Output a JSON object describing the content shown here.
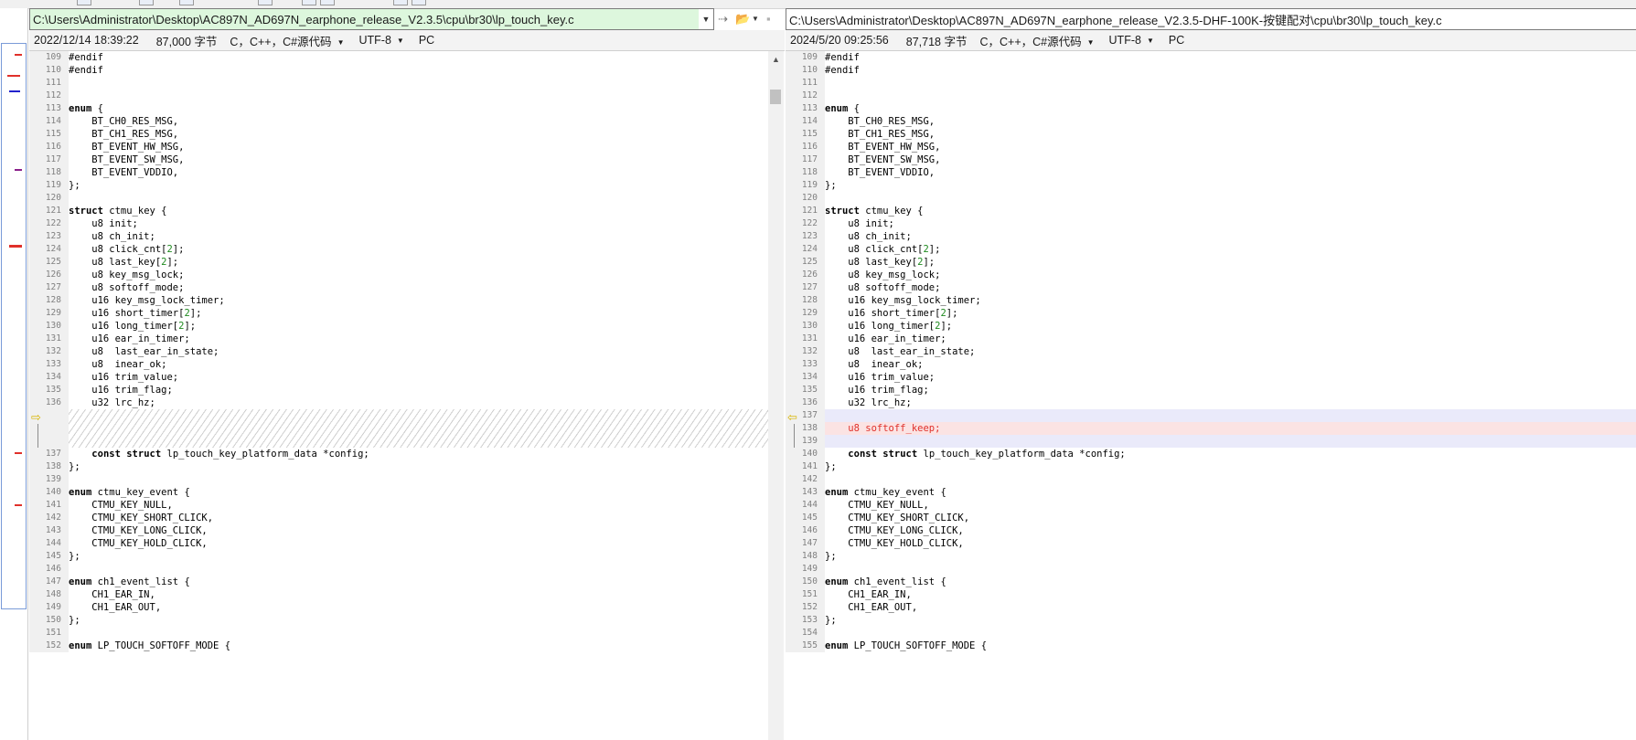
{
  "left": {
    "path": "C:\\Users\\Administrator\\Desktop\\AC897N_AD697N_earphone_release_V2.3.5\\cpu\\br30\\lp_touch_key.c",
    "timestamp": "2022/12/14 18:39:22",
    "size": "87,000 字节",
    "language": "C，C++，C#源代码",
    "encoding": "UTF-8",
    "line_ending": "PC"
  },
  "right": {
    "path": "C:\\Users\\Administrator\\Desktop\\AC897N_AD697N_earphone_release_V2.3.5-DHF-100K-按键配对\\cpu\\br30\\lp_touch_key.c",
    "timestamp": "2024/5/20 09:25:56",
    "size": "87,718 字节",
    "language": "C，C++，C#源代码",
    "encoding": "UTF-8",
    "line_ending": "PC"
  },
  "colors": {
    "left_path_bg": "#ddf7dd",
    "added_line_bg": "#fbe3e3",
    "added_line_text": "#e0302a",
    "blank_diff_bg": "#eaeafa",
    "number_literal": "#1f8a1f",
    "diff_arrow": "#d8b400"
  },
  "icons": {
    "combo_arrow": "chevron-down-icon",
    "next_diff": "next-difference-icon",
    "open_folder": "folder-open-icon",
    "save": "save-icon",
    "scroll_up": "scroll-up-icon",
    "diff_arrow_left": "arrow-right-icon",
    "diff_arrow_right": "arrow-left-icon"
  },
  "left_lines": [
    {
      "n": "109",
      "t": "#endif"
    },
    {
      "n": "110",
      "t": "#endif"
    },
    {
      "n": "111",
      "t": ""
    },
    {
      "n": "112",
      "t": ""
    },
    {
      "n": "113",
      "t": "enum {"
    },
    {
      "n": "114",
      "t": "    BT_CH0_RES_MSG,"
    },
    {
      "n": "115",
      "t": "    BT_CH1_RES_MSG,"
    },
    {
      "n": "116",
      "t": "    BT_EVENT_HW_MSG,"
    },
    {
      "n": "117",
      "t": "    BT_EVENT_SW_MSG,"
    },
    {
      "n": "118",
      "t": "    BT_EVENT_VDDIO,"
    },
    {
      "n": "119",
      "t": "};"
    },
    {
      "n": "120",
      "t": ""
    },
    {
      "n": "121",
      "t": "struct ctmu_key {"
    },
    {
      "n": "122",
      "t": "    u8 init;"
    },
    {
      "n": "123",
      "t": "    u8 ch_init;"
    },
    {
      "n": "124",
      "t": "    u8 click_cnt[2];"
    },
    {
      "n": "125",
      "t": "    u8 last_key[2];"
    },
    {
      "n": "126",
      "t": "    u8 key_msg_lock;"
    },
    {
      "n": "127",
      "t": "    u8 softoff_mode;"
    },
    {
      "n": "128",
      "t": "    u16 key_msg_lock_timer;"
    },
    {
      "n": "129",
      "t": "    u16 short_timer[2];"
    },
    {
      "n": "130",
      "t": "    u16 long_timer[2];"
    },
    {
      "n": "131",
      "t": "    u16 ear_in_timer;"
    },
    {
      "n": "132",
      "t": "    u8  last_ear_in_state;"
    },
    {
      "n": "133",
      "t": "    u8  inear_ok;"
    },
    {
      "n": "134",
      "t": "    u16 trim_value;"
    },
    {
      "n": "135",
      "t": "    u16 trim_flag;"
    },
    {
      "n": "136",
      "t": "    u32 lrc_hz;"
    },
    {
      "n": "",
      "t": "",
      "kind": "placeholder"
    },
    {
      "n": "137",
      "t": "    const struct lp_touch_key_platform_data *config;"
    },
    {
      "n": "138",
      "t": "};"
    },
    {
      "n": "139",
      "t": ""
    },
    {
      "n": "140",
      "t": "enum ctmu_key_event {"
    },
    {
      "n": "141",
      "t": "    CTMU_KEY_NULL,"
    },
    {
      "n": "142",
      "t": "    CTMU_KEY_SHORT_CLICK,"
    },
    {
      "n": "143",
      "t": "    CTMU_KEY_LONG_CLICK,"
    },
    {
      "n": "144",
      "t": "    CTMU_KEY_HOLD_CLICK,"
    },
    {
      "n": "145",
      "t": "};"
    },
    {
      "n": "146",
      "t": ""
    },
    {
      "n": "147",
      "t": "enum ch1_event_list {"
    },
    {
      "n": "148",
      "t": "    CH1_EAR_IN,"
    },
    {
      "n": "149",
      "t": "    CH1_EAR_OUT,"
    },
    {
      "n": "150",
      "t": "};"
    },
    {
      "n": "151",
      "t": ""
    },
    {
      "n": "152",
      "t": "enum LP_TOUCH_SOFTOFF_MODE {"
    }
  ],
  "right_lines": [
    {
      "n": "109",
      "t": "#endif"
    },
    {
      "n": "110",
      "t": "#endif"
    },
    {
      "n": "111",
      "t": ""
    },
    {
      "n": "112",
      "t": ""
    },
    {
      "n": "113",
      "t": "enum {"
    },
    {
      "n": "114",
      "t": "    BT_CH0_RES_MSG,"
    },
    {
      "n": "115",
      "t": "    BT_CH1_RES_MSG,"
    },
    {
      "n": "116",
      "t": "    BT_EVENT_HW_MSG,"
    },
    {
      "n": "117",
      "t": "    BT_EVENT_SW_MSG,"
    },
    {
      "n": "118",
      "t": "    BT_EVENT_VDDIO,"
    },
    {
      "n": "119",
      "t": "};"
    },
    {
      "n": "120",
      "t": ""
    },
    {
      "n": "121",
      "t": "struct ctmu_key {"
    },
    {
      "n": "122",
      "t": "    u8 init;"
    },
    {
      "n": "123",
      "t": "    u8 ch_init;"
    },
    {
      "n": "124",
      "t": "    u8 click_cnt[2];"
    },
    {
      "n": "125",
      "t": "    u8 last_key[2];"
    },
    {
      "n": "126",
      "t": "    u8 key_msg_lock;"
    },
    {
      "n": "127",
      "t": "    u8 softoff_mode;"
    },
    {
      "n": "128",
      "t": "    u16 key_msg_lock_timer;"
    },
    {
      "n": "129",
      "t": "    u16 short_timer[2];"
    },
    {
      "n": "130",
      "t": "    u16 long_timer[2];"
    },
    {
      "n": "131",
      "t": "    u16 ear_in_timer;"
    },
    {
      "n": "132",
      "t": "    u8  last_ear_in_state;"
    },
    {
      "n": "133",
      "t": "    u8  inear_ok;"
    },
    {
      "n": "134",
      "t": "    u16 trim_value;"
    },
    {
      "n": "135",
      "t": "    u16 trim_flag;"
    },
    {
      "n": "136",
      "t": "    u32 lrc_hz;"
    },
    {
      "n": "137",
      "t": "",
      "kind": "blank"
    },
    {
      "n": "138",
      "t": "    u8 softoff_keep;",
      "kind": "added"
    },
    {
      "n": "139",
      "t": "",
      "kind": "blank"
    },
    {
      "n": "140",
      "t": "    const struct lp_touch_key_platform_data *config;"
    },
    {
      "n": "141",
      "t": "};"
    },
    {
      "n": "142",
      "t": ""
    },
    {
      "n": "143",
      "t": "enum ctmu_key_event {"
    },
    {
      "n": "144",
      "t": "    CTMU_KEY_NULL,"
    },
    {
      "n": "145",
      "t": "    CTMU_KEY_SHORT_CLICK,"
    },
    {
      "n": "146",
      "t": "    CTMU_KEY_LONG_CLICK,"
    },
    {
      "n": "147",
      "t": "    CTMU_KEY_HOLD_CLICK,"
    },
    {
      "n": "148",
      "t": "};"
    },
    {
      "n": "149",
      "t": ""
    },
    {
      "n": "150",
      "t": "enum ch1_event_list {"
    },
    {
      "n": "151",
      "t": "    CH1_EAR_IN,"
    },
    {
      "n": "152",
      "t": "    CH1_EAR_OUT,"
    },
    {
      "n": "153",
      "t": "};"
    },
    {
      "n": "154",
      "t": ""
    },
    {
      "n": "155",
      "t": "enum LP_TOUCH_SOFTOFF_MODE {"
    }
  ]
}
